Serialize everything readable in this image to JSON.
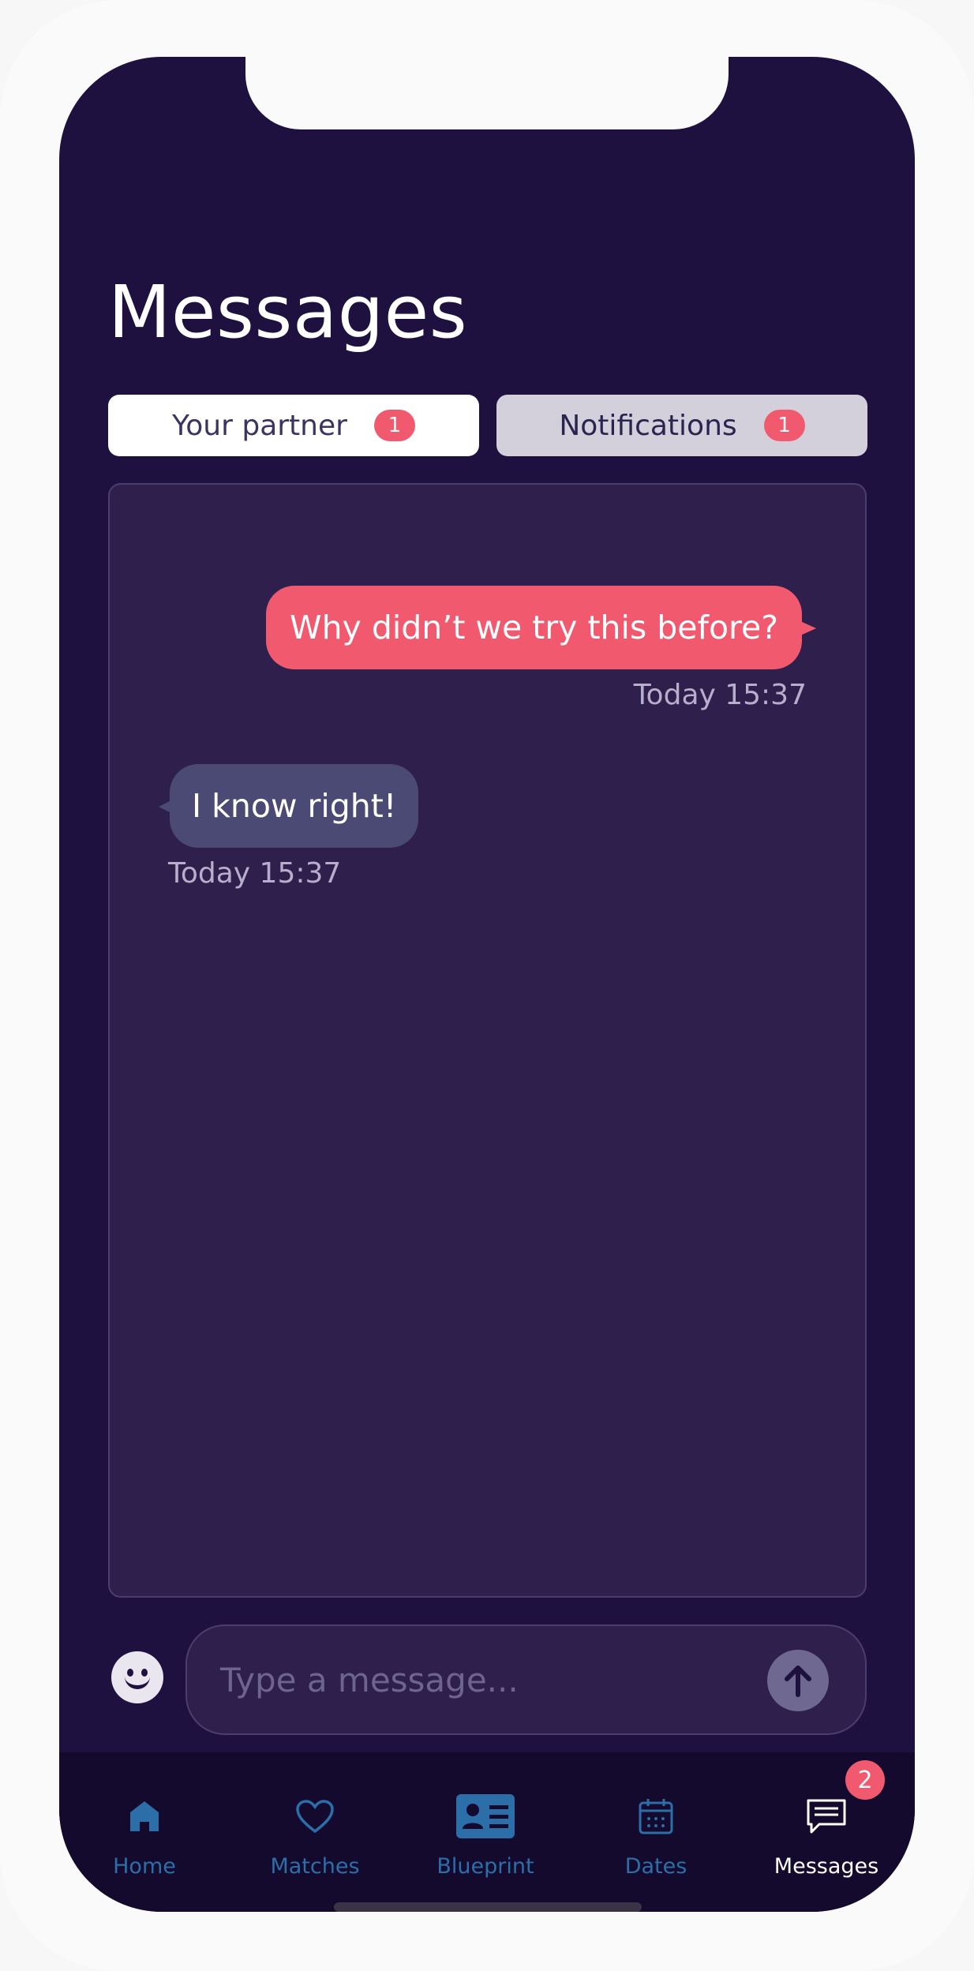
{
  "header": {
    "title": "Messages"
  },
  "tabs": [
    {
      "label": "Your partner",
      "badge": "1",
      "active": true
    },
    {
      "label": "Notifications",
      "badge": "1",
      "active": false
    }
  ],
  "messages": [
    {
      "direction": "outgoing",
      "text": "Why didn’t we try this before?",
      "time": "Today 15:37"
    },
    {
      "direction": "incoming",
      "text": "I know right!",
      "time": "Today 15:37"
    }
  ],
  "composer": {
    "placeholder": "Type a message...",
    "emoji_icon": "smiley-icon",
    "send_icon": "arrow-up-icon"
  },
  "bottom_nav": [
    {
      "label": "Home",
      "icon": "home-icon"
    },
    {
      "label": "Matches",
      "icon": "heart-icon"
    },
    {
      "label": "Blueprint",
      "icon": "id-card-icon"
    },
    {
      "label": "Dates",
      "icon": "calendar-icon"
    },
    {
      "label": "Messages",
      "icon": "chat-icon",
      "badge": "2",
      "active": true
    }
  ],
  "colors": {
    "background": "#1e1140",
    "accent": "#f15a6e",
    "nav_inactive": "#2b6ea8"
  }
}
